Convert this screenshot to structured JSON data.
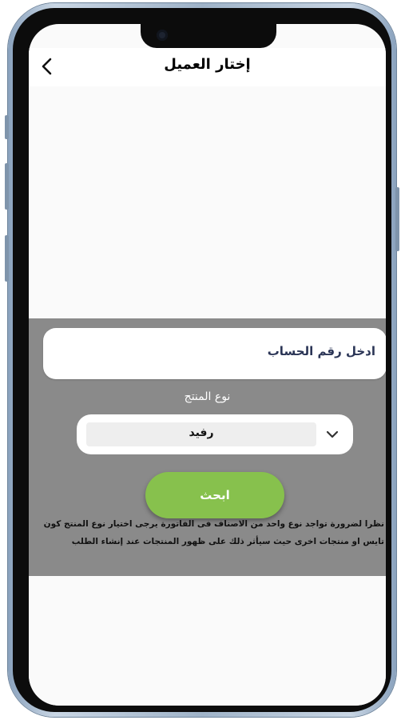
{
  "header": {
    "title": "إختار العميل",
    "back_icon": "chevron-left-icon"
  },
  "form": {
    "account_label": "ادخل رقم الحساب",
    "product_type_label": "نوع المنتج",
    "product_type_selected": "رفيد",
    "dropdown_icon": "chevron-down-icon",
    "search_button_label": "ابحث"
  },
  "note": {
    "line1": "نظرا لضرورة تواجد نوع واحد من الاصناف فى الفاتورة يرجى اختيار نوع المنتج كون",
    "line2": "تايس او منتجات اخرى حيث سيأثر ذلك على ظهور المنتجات عند إنشاء الطلب"
  },
  "colors": {
    "panel": "#8a8a8a",
    "search_button": "#87c14d",
    "account_label": "#2b3556"
  }
}
